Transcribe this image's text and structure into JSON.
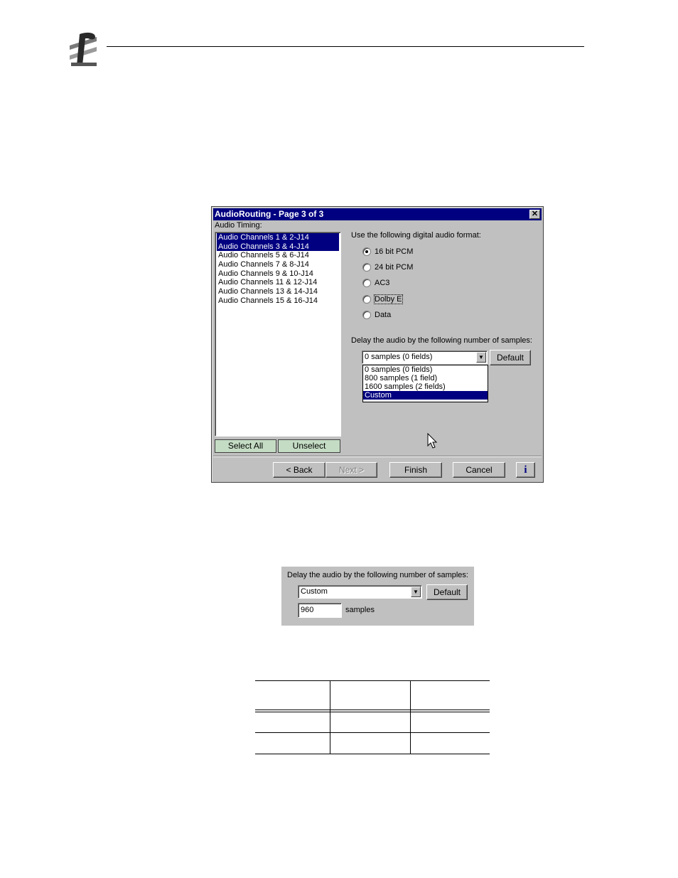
{
  "dialog": {
    "title": "AudioRouting - Page 3 of 3",
    "close_glyph": "✕",
    "audio_timing_label": "Audio Timing:",
    "channels": [
      {
        "label": "Audio Channels 1 & 2-J14",
        "selected": true
      },
      {
        "label": "Audio Channels 3 & 4-J14",
        "selected": true
      },
      {
        "label": "Audio Channels 5 & 6-J14",
        "selected": false
      },
      {
        "label": "Audio Channels 7 & 8-J14",
        "selected": false
      },
      {
        "label": "Audio Channels 9 & 10-J14",
        "selected": false
      },
      {
        "label": "Audio Channels 11 & 12-J14",
        "selected": false
      },
      {
        "label": "Audio Channels 13 & 14-J14",
        "selected": false
      },
      {
        "label": "Audio Channels 15 & 16-J14",
        "selected": false
      }
    ],
    "select_all_label": "Select All",
    "unselect_label": "Unselect",
    "format_prompt": "Use the following digital audio format:",
    "formats": [
      {
        "label": "16 bit PCM",
        "checked": true
      },
      {
        "label": "24 bit PCM",
        "checked": false
      },
      {
        "label": "AC3",
        "checked": false
      },
      {
        "label": "Dolby E",
        "checked": false
      },
      {
        "label": "Data",
        "checked": false
      }
    ],
    "delay_prompt": "Delay the audio by the following number of samples:",
    "delay_value": "0 samples (0 fields)",
    "default_label": "Default",
    "delay_options": [
      {
        "label": "0 samples (0 fields)",
        "selected": false
      },
      {
        "label": "800 samples (1 field)",
        "selected": false
      },
      {
        "label": "1600 samples (2  fields)",
        "selected": false
      },
      {
        "label": "Custom",
        "selected": true
      }
    ],
    "buttons": {
      "back": "< Back",
      "next": "Next >",
      "finish": "Finish",
      "cancel": "Cancel",
      "info": "i"
    }
  },
  "custom_panel": {
    "delay_prompt": "Delay the audio by the following number of samples:",
    "delay_value": "Custom",
    "default_label": "Default",
    "samples_value": "960",
    "samples_label": "samples"
  }
}
